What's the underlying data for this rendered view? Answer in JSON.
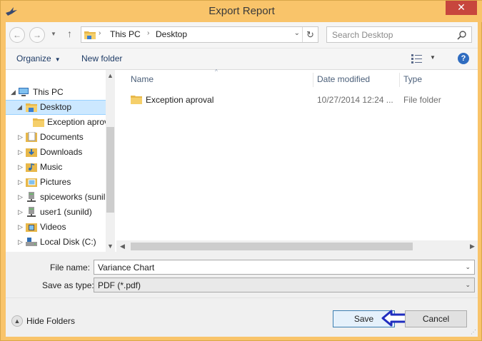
{
  "window": {
    "title": "Export Report",
    "close_glyph": "✕"
  },
  "nav": {
    "back_glyph": "←",
    "forward_glyph": "→",
    "recent_glyph": "▼",
    "up_glyph": "↑",
    "breadcrumb": [
      "This PC",
      "Desktop"
    ],
    "separator": "›",
    "dropdown_glyph": "⌄",
    "refresh_glyph": "↻",
    "search_placeholder": "Search Desktop"
  },
  "toolbar": {
    "organize_label": "Organize",
    "new_folder_label": "New folder",
    "help_glyph": "?",
    "dropdown_glyph": "▼"
  },
  "tree": {
    "items": [
      {
        "label": "This PC",
        "expander": "◢",
        "icon": "pc-icon"
      },
      {
        "label": "Desktop",
        "expander": "◢",
        "icon": "folder-icon",
        "selected": true
      },
      {
        "label": "Exception aprov",
        "expander": "",
        "icon": "folder-icon"
      },
      {
        "label": "Documents",
        "expander": "▷",
        "icon": "documents-icon"
      },
      {
        "label": "Downloads",
        "expander": "▷",
        "icon": "downloads-icon"
      },
      {
        "label": "Music",
        "expander": "▷",
        "icon": "music-icon"
      },
      {
        "label": "Pictures",
        "expander": "▷",
        "icon": "pictures-icon"
      },
      {
        "label": "spiceworks (sunil",
        "expander": "▷",
        "icon": "network-drive-icon"
      },
      {
        "label": "user1 (sunild)",
        "expander": "▷",
        "icon": "network-drive-icon"
      },
      {
        "label": "Videos",
        "expander": "▷",
        "icon": "videos-icon"
      },
      {
        "label": "Local Disk (C:)",
        "expander": "▷",
        "icon": "disk-icon"
      }
    ]
  },
  "list": {
    "columns": [
      "Name",
      "Date modified",
      "Type"
    ],
    "sort_glyph": "^",
    "rows": [
      {
        "name": "Exception aproval",
        "date": "10/27/2014 12:24 ...",
        "type": "File folder"
      }
    ]
  },
  "scrollbars": {
    "up": "▲",
    "down": "▼",
    "left": "◀",
    "right": "▶"
  },
  "form": {
    "filename_label": "File name:",
    "filename_value": "Variance Chart",
    "type_label": "Save as type:",
    "type_value": "PDF (*.pdf)",
    "dropdown_glyph": "⌄"
  },
  "footer": {
    "hide_folders_label": "Hide Folders",
    "hide_glyph": "▲",
    "save_label": "Save",
    "cancel_label": "Cancel",
    "grip_glyph": "⋰"
  },
  "colors": {
    "titlebar": "#f9c46a",
    "close": "#c7463d",
    "annotation_arrow": "#1f2dbf",
    "selection": "#cce8ff"
  }
}
